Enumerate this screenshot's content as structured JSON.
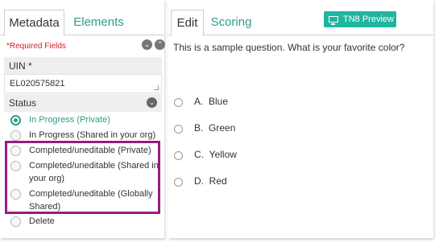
{
  "left": {
    "tabs": [
      {
        "label": "Metadata",
        "active": true
      },
      {
        "label": "Elements",
        "active": false
      }
    ],
    "required_text": "*Required Fields",
    "uin_label": "UIN *",
    "uin_value": "EL020575821",
    "status_label": "Status",
    "status_options": [
      {
        "label": "In Progress (Private)",
        "selected": true
      },
      {
        "label": "In Progress (Shared in your org)",
        "selected": false
      },
      {
        "label": "Completed/uneditable (Private)",
        "selected": false
      },
      {
        "label": "Completed/uneditable (Shared in your org)",
        "selected": false
      },
      {
        "label": "Completed/uneditable (Globally Shared)",
        "selected": false
      },
      {
        "label": "Delete",
        "selected": false
      }
    ]
  },
  "right": {
    "tabs": [
      {
        "label": "Edit",
        "active": true
      },
      {
        "label": "Scoring",
        "active": false
      }
    ],
    "preview_label": "TN8 Preview",
    "question": "This is a sample question. What is your favorite color?",
    "answers": [
      {
        "letter": "A.",
        "text": "Blue"
      },
      {
        "letter": "B.",
        "text": "Green"
      },
      {
        "letter": "C.",
        "text": "Yellow"
      },
      {
        "letter": "D.",
        "text": "Red"
      }
    ]
  },
  "colors": {
    "accent": "#2d9d8a",
    "preview_button": "#20b5a0",
    "required": "#d3222a",
    "highlight": "#9c1a7d"
  }
}
